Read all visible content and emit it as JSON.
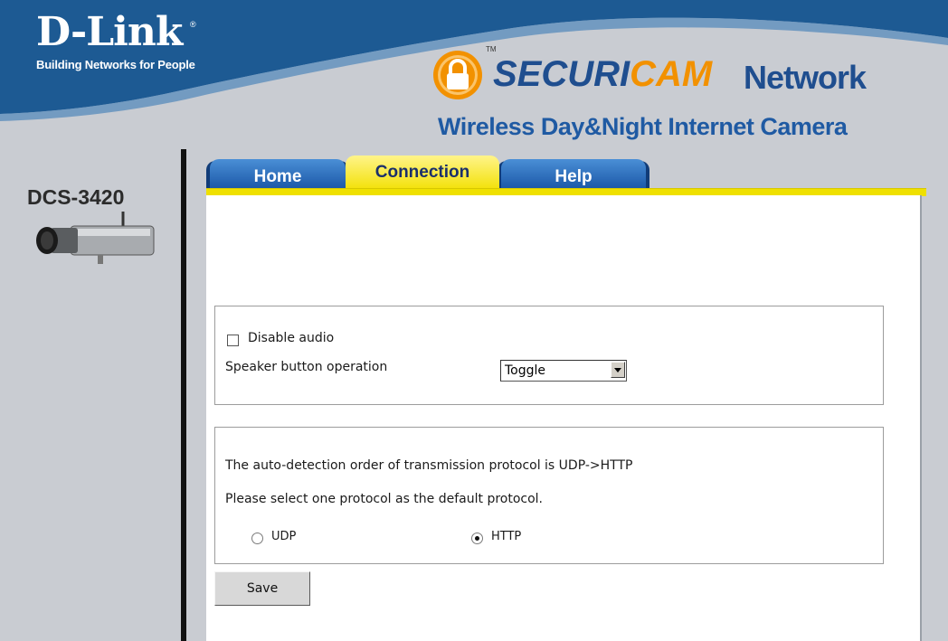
{
  "brand": {
    "logo": "D-Link",
    "registered": "®",
    "tagline": "Building Networks for People",
    "product_prefix": "SECURI",
    "product_accent": "CAM",
    "product_suffix": "Network",
    "trademark": "TM",
    "subtitle": "Wireless Day&Night Internet Camera",
    "seal_icon": "padlock-seal-icon",
    "colors": {
      "blue": "#1f4e8f",
      "orange": "#f29100",
      "yellow": "#efe000"
    }
  },
  "model": {
    "name": "DCS-3420",
    "icon": "camera-icon"
  },
  "tabs": [
    {
      "label": "Home",
      "active": false
    },
    {
      "label": "Connection",
      "active": true
    },
    {
      "label": "Help",
      "active": false
    }
  ],
  "audio": {
    "disable_audio_label": "Disable audio",
    "disable_audio_checked": false,
    "speaker_label": "Speaker button operation",
    "speaker_value": "Toggle"
  },
  "protocol": {
    "info": "The auto-detection order of transmission protocol is UDP->HTTP",
    "prompt": "Please select one protocol as the default protocol.",
    "options": [
      {
        "label": "UDP",
        "selected": false
      },
      {
        "label": "HTTP",
        "selected": true
      }
    ]
  },
  "save_label": "Save"
}
